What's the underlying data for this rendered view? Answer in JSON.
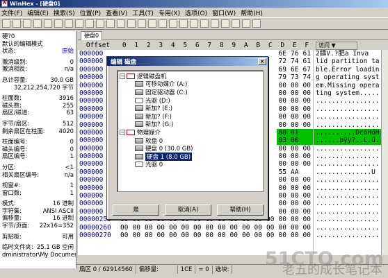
{
  "title": "WinHex - [硬盘0]",
  "menu": [
    "文件(F)",
    "编辑(E)",
    "搜索(S)",
    "位置(P)",
    "查看(V)",
    "工具(T)",
    "专用(X)",
    "选项(O)",
    "窗口(W)",
    "帮助(H)"
  ],
  "tab_label": "硬盘0",
  "left_panel": {
    "header": "硬?0",
    "rows": [
      {
        "k": "默认的编辑模式",
        "v": ""
      },
      {
        "k": "状态:",
        "v": "原始",
        "blue": true
      },
      {
        "k": "",
        "v": ""
      },
      {
        "k": "撤消级别:",
        "v": "0"
      },
      {
        "k": "撤消相反:",
        "v": "n/a"
      },
      {
        "k": "",
        "v": ""
      },
      {
        "k": "总计容量:",
        "v": "30.0 GB"
      },
      {
        "k": "",
        "v": "32,212,254,720 字节"
      },
      {
        "k": "",
        "v": ""
      },
      {
        "k": "柱面数:",
        "v": "3916"
      },
      {
        "k": "磁头数:",
        "v": "255"
      },
      {
        "k": "扇区/磁道:",
        "v": "63"
      },
      {
        "k": "",
        "v": ""
      },
      {
        "k": "字节/扇区:",
        "v": "512"
      },
      {
        "k": "剩余扇区在柱面:",
        "v": "4020"
      },
      {
        "k": "",
        "v": ""
      },
      {
        "k": "柱面编号:",
        "v": "0"
      },
      {
        "k": "磁头编号:",
        "v": "0"
      },
      {
        "k": "扇区编号:",
        "v": "1"
      },
      {
        "k": "",
        "v": ""
      },
      {
        "k": "分区:",
        "v": "<1"
      },
      {
        "k": "相关扇区编号:",
        "v": "n/a"
      },
      {
        "k": "",
        "v": ""
      },
      {
        "k": "视窗#:",
        "v": "1"
      },
      {
        "k": "窗口数:",
        "v": "1"
      },
      {
        "k": "",
        "v": ""
      },
      {
        "k": "模式:",
        "v": "16 进制"
      },
      {
        "k": "字符集:",
        "v": "ANSI ASCII"
      },
      {
        "k": "偏移量:",
        "v": "16 进制"
      },
      {
        "k": "字节/页面:",
        "v": "22x16=352"
      },
      {
        "k": "",
        "v": ""
      },
      {
        "k": "剪贴板:",
        "v": "可用"
      },
      {
        "k": "",
        "v": ""
      },
      {
        "k": "临时文件夹:",
        "v": "25.1 GB 空闲"
      },
      {
        "k": "dministrator\\My Documents",
        "v": ""
      }
    ]
  },
  "hex_header": {
    "offset": "Offset",
    "cols": [
      "0",
      "1",
      "2",
      "3",
      "4",
      "5",
      "6",
      "7",
      "8",
      "9",
      "A",
      "B",
      "C",
      "D",
      "E",
      "F"
    ]
  },
  "hex_rows": [
    {
      "o": "000000",
      "b": [
        "",
        "",
        "",
        "",
        "",
        "",
        "",
        "",
        "",
        "",
        "",
        "",
        "",
        "6E",
        "76",
        "61"
      ]
    },
    {
      "o": "000000",
      "b": [
        "",
        "",
        "",
        "",
        "",
        "",
        "",
        "",
        "",
        "",
        "",
        "",
        "",
        "72",
        "74",
        "61"
      ]
    },
    {
      "o": "000000",
      "b": [
        "",
        "",
        "",
        "",
        "",
        "",
        "",
        "",
        "",
        "",
        "",
        "",
        "",
        "69",
        "6E",
        "67"
      ]
    },
    {
      "o": "000000",
      "b": [
        "",
        "",
        "",
        "",
        "",
        "",
        "",
        "",
        "",
        "",
        "",
        "",
        "",
        "79",
        "73",
        "74"
      ]
    },
    {
      "o": "000000",
      "b": [
        "",
        "",
        "",
        "",
        "",
        "",
        "",
        "",
        "",
        "",
        "",
        "",
        "",
        "00",
        "00",
        "00"
      ]
    },
    {
      "o": "000000",
      "b": [
        "",
        "",
        "",
        "",
        "",
        "",
        "",
        "",
        "",
        "",
        "",
        "",
        "",
        "00",
        "00",
        "00"
      ]
    },
    {
      "o": "000000",
      "b": [
        "",
        "",
        "",
        "",
        "",
        "",
        "",
        "",
        "",
        "",
        "",
        "",
        "",
        "00",
        "00",
        "00"
      ]
    },
    {
      "o": "000000",
      "b": [
        "",
        "",
        "",
        "",
        "",
        "",
        "",
        "",
        "",
        "",
        "",
        "",
        "",
        "00",
        "00",
        "00"
      ]
    },
    {
      "o": "000000",
      "b": [
        "",
        "",
        "",
        "",
        "",
        "",
        "",
        "",
        "",
        "",
        "",
        "",
        "",
        "00",
        "00",
        "00"
      ]
    },
    {
      "o": "000000",
      "b": [
        "",
        "",
        "",
        "",
        "",
        "",
        "",
        "",
        "",
        "",
        "",
        "",
        "",
        "00",
        "00",
        "00"
      ]
    },
    {
      "o": "000000",
      "b": [
        "",
        "",
        "",
        "",
        "",
        "",
        "",
        "",
        "",
        "",
        "",
        "",
        "",
        "80",
        "01",
        ""
      ]
    },
    {
      "o": "000000",
      "b": [
        "",
        "",
        "",
        "",
        "",
        "",
        "",
        "",
        "",
        "",
        "",
        "",
        "",
        "03",
        "00",
        ""
      ]
    },
    {
      "o": "000000",
      "b": [
        "",
        "",
        "",
        "",
        "",
        "",
        "",
        "",
        "",
        "",
        "",
        "",
        "",
        "00",
        "00",
        "00"
      ]
    },
    {
      "o": "000000",
      "b": [
        "",
        "",
        "",
        "",
        "",
        "",
        "",
        "",
        "",
        "",
        "",
        "",
        "",
        "00",
        "00",
        "00"
      ]
    },
    {
      "o": "000000",
      "b": [
        "",
        "",
        "",
        "",
        "",
        "",
        "",
        "",
        "",
        "",
        "",
        "",
        "",
        "00",
        "00",
        "00"
      ]
    },
    {
      "o": "000000",
      "b": [
        "",
        "",
        "",
        "",
        "",
        "",
        "",
        "",
        "",
        "",
        "",
        "",
        "",
        "55",
        "AA",
        ""
      ]
    },
    {
      "o": "000000",
      "b": [
        "",
        "",
        "",
        "",
        "",
        "",
        "",
        "",
        "",
        "",
        "",
        "",
        "",
        "00",
        "00",
        "00"
      ]
    },
    {
      "o": "000000",
      "b": [
        "",
        "",
        "",
        "",
        "",
        "",
        "",
        "",
        "",
        "",
        "",
        "",
        "",
        "00",
        "00",
        "00"
      ]
    },
    {
      "o": "000000",
      "b": [
        "",
        "",
        "",
        "",
        "",
        "",
        "",
        "",
        "",
        "",
        "",
        "",
        "",
        "00",
        "00",
        "00"
      ]
    },
    {
      "o": "000000",
      "b": [
        "",
        "",
        "",
        "",
        "",
        "",
        "",
        "",
        "",
        "",
        "",
        "",
        "",
        "00",
        "00",
        "00"
      ]
    },
    {
      "o": "000000",
      "b": [
        "",
        "",
        "",
        "",
        "",
        "",
        "",
        "",
        "",
        "",
        "",
        "",
        "",
        "00",
        "00",
        "00"
      ]
    },
    {
      "o": "00000250",
      "b": [
        "00",
        "00",
        "00",
        "00",
        "00",
        "00",
        "00",
        "00",
        "00",
        "00",
        "00",
        "00",
        "00",
        "00",
        "00",
        "00"
      ]
    },
    {
      "o": "00000260",
      "b": [
        "00",
        "00",
        "00",
        "00",
        "00",
        "00",
        "00",
        "00",
        "00",
        "00",
        "00",
        "00",
        "00",
        "00",
        "00",
        "00"
      ]
    },
    {
      "o": "00000270",
      "b": [
        "00",
        "00",
        "00",
        "00",
        "00",
        "00",
        "00",
        "00",
        "00",
        "00",
        "00",
        "00",
        "00",
        "00",
        "00",
        "00"
      ]
    }
  ],
  "ascii_header": "访问",
  "ascii_rows": [
    "2鑄V.?肥a  Inva",
    "lid partition ta",
    "ble.Error loadin",
    "g operating syst",
    "em.Missing opera",
    "ting system.....",
    "................",
    "................",
    "................",
    "................",
    "..........DcóHóH..E.",
    "......þÿÿ?..L.ü....",
    "................",
    "................",
    "................",
    "..............U",
    "................",
    "................",
    "................",
    "................",
    "................",
    "................",
    "................",
    "................"
  ],
  "status": {
    "sector": "扇区 0 / 62914560",
    "offset_label": "偏移量:",
    "offset_value": "1CE",
    "value": "= 0",
    "selection": "选块:"
  },
  "dialog": {
    "title": "编辑 磁盘",
    "logical_group": "逻辑磁盘机",
    "logical_items": [
      "可移动媒介 (A:)",
      "固定驱动器 (C:)",
      "光驱 (D:)",
      "新加? (E:)",
      "新加? (F:)",
      "新加? (G:)"
    ],
    "physical_group": "物理媒介",
    "physical_items": [
      "软盘 0",
      "硬盘 0 (30.0 GB)",
      "硬盘 1 (8.0 GB)",
      "光驱 0"
    ],
    "selected_index": 2,
    "ok": "是",
    "cancel": "取消(A)",
    "help": "帮助(H)",
    "close": "×"
  },
  "watermark": "51CTO.com",
  "watermark2": "老五的成长笔记本"
}
